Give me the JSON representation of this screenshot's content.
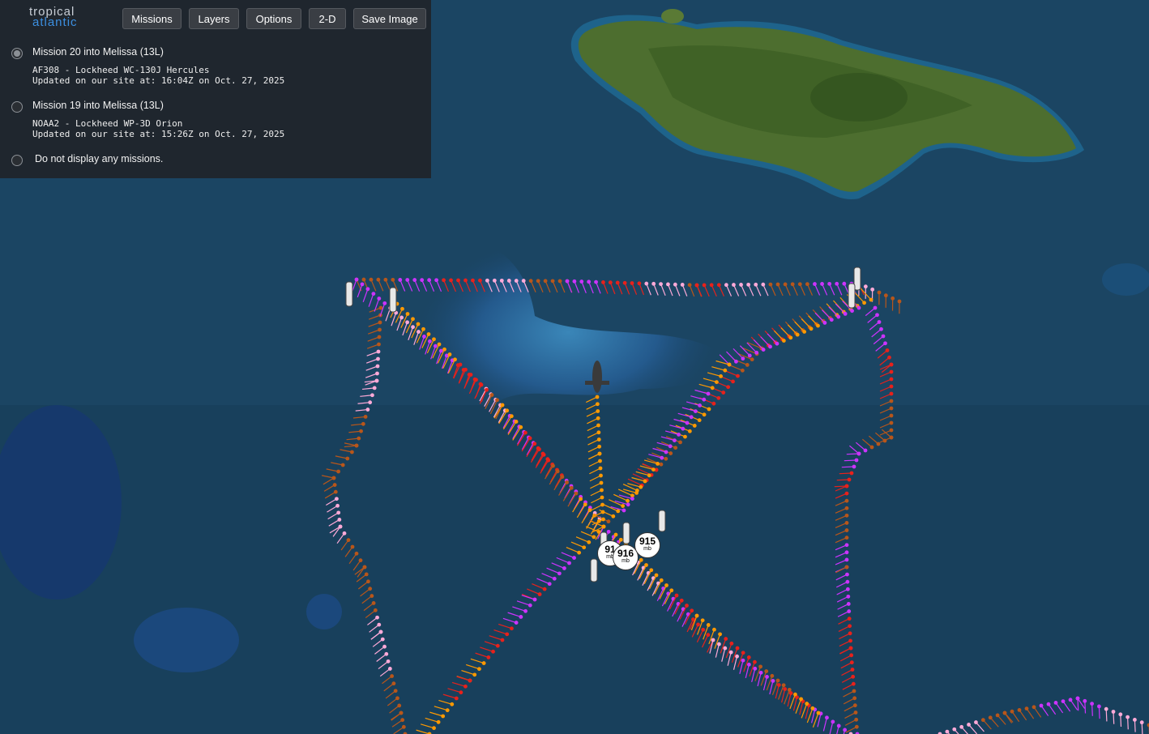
{
  "logo": {
    "line1": "tropical",
    "line2": "atlantic"
  },
  "toolbar": {
    "missions_label": "Missions",
    "layers_label": "Layers",
    "options_label": "Options",
    "view_label": "2-D",
    "save_label": "Save Image"
  },
  "missions": [
    {
      "title": "Mission 20 into Melissa (13L)",
      "aircraft": "AF308 - Lockheed WC-130J Hercules",
      "updated": "Updated on our site at: 16:04Z on Oct. 27, 2025",
      "selected": true
    },
    {
      "title": "Mission 19 into Melissa (13L)",
      "aircraft": "NOAA2 - Lockheed WP-3D Orion",
      "updated": "Updated on our site at: 15:26Z on Oct. 27, 2025",
      "selected": false
    }
  ],
  "none_option": {
    "title": "Do not display any missions.",
    "selected": false
  },
  "pressure_markers": [
    {
      "value": "91",
      "unit": "mb"
    },
    {
      "value": "916",
      "unit": "mb"
    },
    {
      "value": "915",
      "unit": "mb"
    }
  ],
  "colors": {
    "ocean": "#1a4a66",
    "land": "#4a6e2c",
    "track_orange": "#ff9900",
    "track_magenta": "#cc33ff",
    "track_red": "#e8211b",
    "track_pink": "#ffaad8",
    "track_brown": "#b8561a"
  }
}
